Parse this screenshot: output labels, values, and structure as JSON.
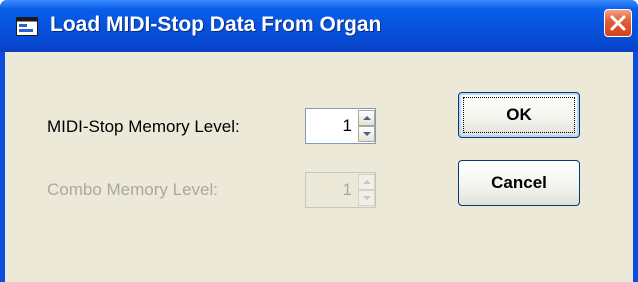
{
  "window": {
    "title": "Load MIDI-Stop Data From Organ",
    "icon": "window-app-icon",
    "close_icon": "close-icon",
    "colors": {
      "titlebar": "#0653dc",
      "client": "#ece9d8",
      "close": "#d2421c"
    }
  },
  "form": {
    "midi_stop_label": "MIDI-Stop Memory Level:",
    "midi_stop_value": "1",
    "combo_label": "Combo Memory Level:",
    "combo_value": "1"
  },
  "buttons": {
    "ok_label": "OK",
    "cancel_label": "Cancel"
  }
}
